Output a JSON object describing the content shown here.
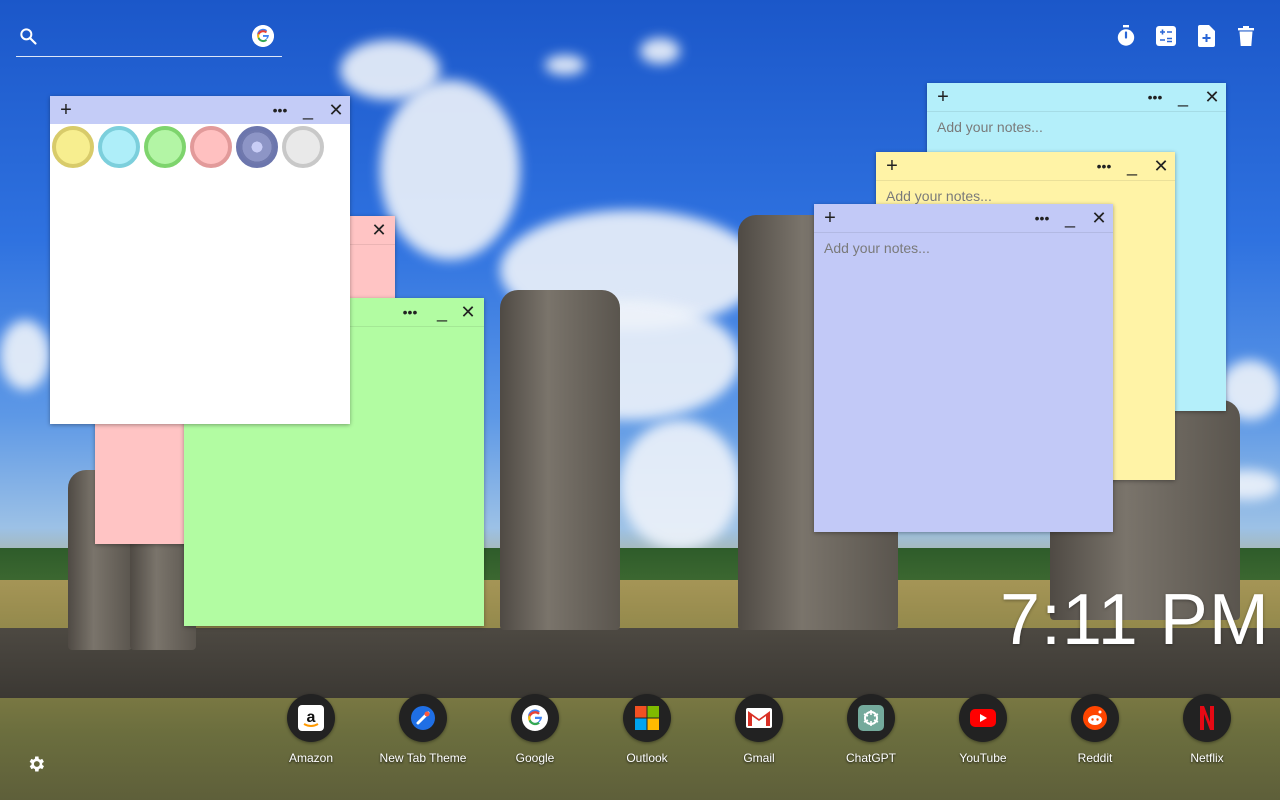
{
  "search": {
    "placeholder": ""
  },
  "notes": {
    "white": {
      "colors": [
        "#f7ee8f",
        "#aeeef9",
        "#b3f5a5",
        "#ffc0c0",
        "#8d95c6",
        "#e9e9e9"
      ]
    },
    "pink": {},
    "green": {},
    "cyan": {
      "placeholder": "Add your notes..."
    },
    "yellow": {
      "placeholder": "Add your notes..."
    },
    "blue": {
      "placeholder": "Add your notes..."
    }
  },
  "clock": {
    "time": "7:11 PM"
  },
  "dock": {
    "apps": [
      {
        "label": "Amazon",
        "icon": "amazon-icon"
      },
      {
        "label": "New Tab Theme",
        "icon": "new-tab-theme-icon"
      },
      {
        "label": "Google",
        "icon": "google-icon"
      },
      {
        "label": "Outlook",
        "icon": "outlook-icon"
      },
      {
        "label": "Gmail",
        "icon": "gmail-icon"
      },
      {
        "label": "ChatGPT",
        "icon": "chatgpt-icon"
      },
      {
        "label": "YouTube",
        "icon": "youtube-icon"
      },
      {
        "label": "Reddit",
        "icon": "reddit-icon"
      },
      {
        "label": "Netflix",
        "icon": "netflix-icon"
      }
    ]
  },
  "toolbar": {
    "icons": [
      "timer-icon",
      "calculator-icon",
      "add-note-icon",
      "trash-icon"
    ]
  },
  "colors": {
    "note_white": "#ffffff",
    "note_pink": "#ffc4c4",
    "note_green": "#b2fca2",
    "note_cyan": "#b4effa",
    "note_yellow": "#fff3a6",
    "note_blue": "#c2c9f7"
  }
}
